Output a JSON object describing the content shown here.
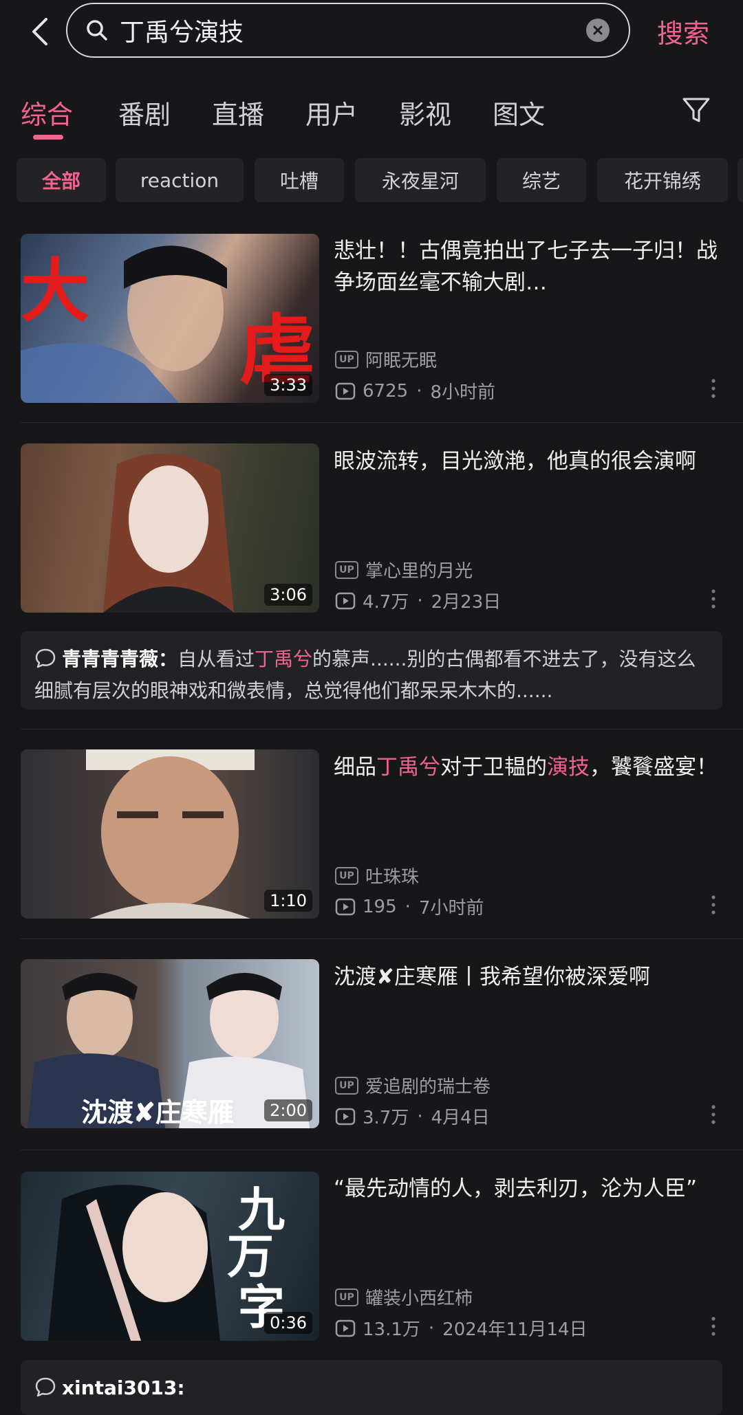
{
  "search": {
    "query": "丁禹兮演技",
    "button": "搜索"
  },
  "tabs": [
    {
      "label": "综合",
      "active": true
    },
    {
      "label": "番剧"
    },
    {
      "label": "直播"
    },
    {
      "label": "用户"
    },
    {
      "label": "影视"
    },
    {
      "label": "图文"
    }
  ],
  "chips": [
    "全部",
    "reaction",
    "吐槽",
    "永夜星河",
    "综艺",
    "花开锦绣"
  ],
  "videos": [
    {
      "thumb_text": [
        "大",
        "虐"
      ],
      "duration": "3:33",
      "title": "悲壮！！古偶竟拍出了七子去一子归！战争场面丝毫不输大剧…",
      "uploader": "阿眠无眠",
      "views": "6725",
      "date": "8小时前"
    },
    {
      "duration": "3:06",
      "title": "眼波流转，目光潋滟，他真的很会演啊",
      "uploader": "掌心里的月光",
      "views": "4.7万",
      "date": "2月23日",
      "comment": {
        "author": "青青青青薇：",
        "before": "自从看过",
        "highlight": "丁禹兮",
        "after": "的慕声......别的古偶都看不进去了，没有这么细腻有层次的眼神戏和微表情，总觉得他们都呆呆木木的......"
      }
    },
    {
      "duration": "1:10",
      "title_parts": [
        "细品",
        "丁禹兮",
        "对于卫韫的",
        "演技",
        "，饕餮盛宴！"
      ],
      "uploader": "吐珠珠",
      "views": "195",
      "date": "7小时前"
    },
    {
      "duration": "2:00",
      "thumb_caption": "沈渡✘庄寒雁",
      "title": "沈渡✘庄寒雁丨我希望你被深爱啊",
      "uploader": "爱追剧的瑞士卷",
      "views": "3.7万",
      "date": "4月4日"
    },
    {
      "duration": "0:36",
      "thumb_text": [
        "九",
        "万",
        "字"
      ],
      "title": "“最先动情的人，剥去利刃，沦为人臣”",
      "uploader": "罐装小西红柿",
      "views": "13.1万",
      "date": "2024年11月14日",
      "comment": {
        "author": "xintai3013:"
      }
    }
  ],
  "labels": {
    "up": "UP",
    "dot": "·"
  },
  "colors": {
    "accent": "#f2648f",
    "background": "#17171a"
  }
}
